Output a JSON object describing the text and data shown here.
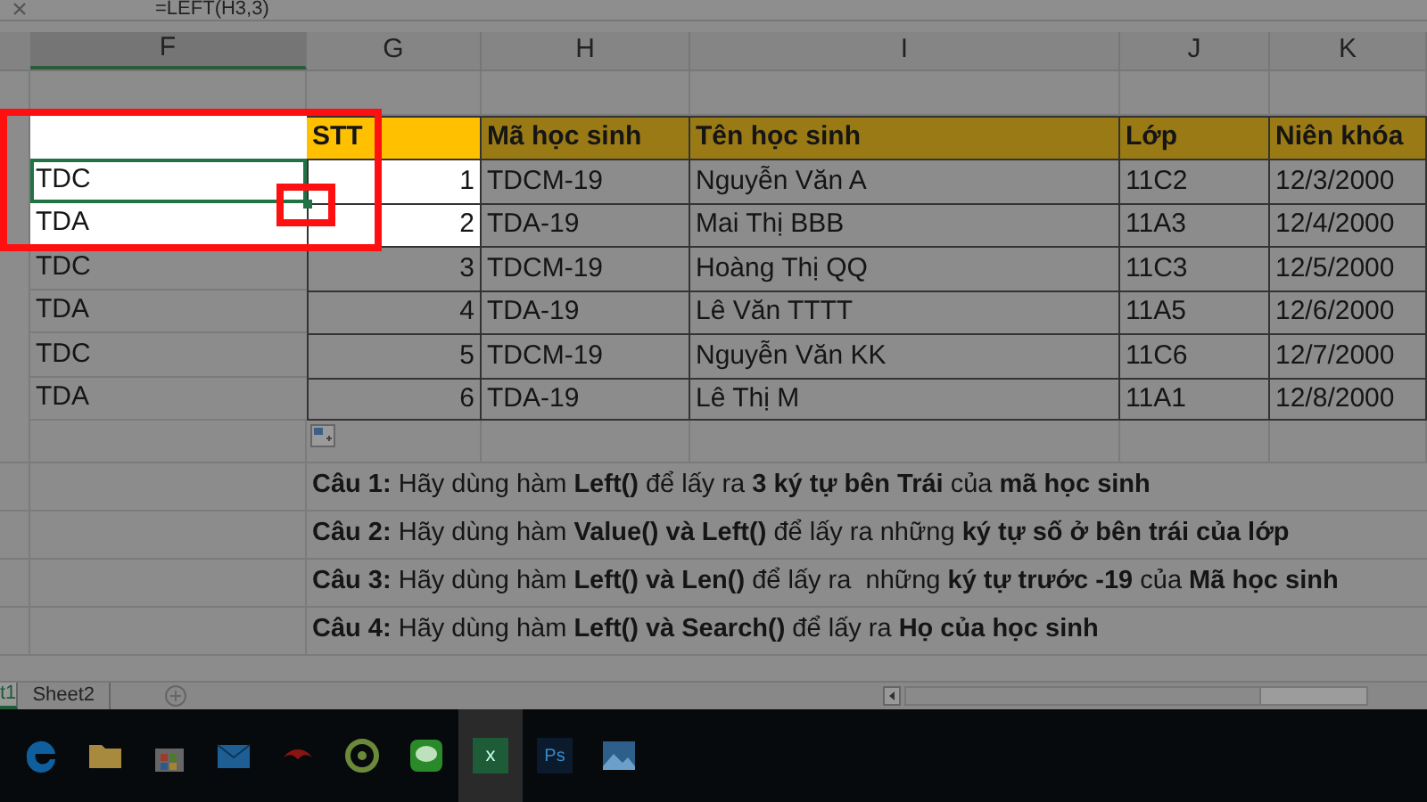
{
  "formula_bar": {
    "formula": "=LEFT(H3,3)"
  },
  "columns": [
    "F",
    "G",
    "H",
    "I",
    "J",
    "K"
  ],
  "table": {
    "headers": [
      "STT",
      "Mã học sinh",
      "Tên học sinh",
      "Lớp",
      "Niên khóa"
    ],
    "rows": [
      {
        "helper": "TDC",
        "selected": true,
        "highlighted": true,
        "cells": [
          "1",
          "TDCM-19",
          "Nguyễn Văn A",
          "11C2",
          "12/3/2000"
        ]
      },
      {
        "helper": "TDA",
        "selected": false,
        "highlighted": true,
        "cells": [
          "2",
          "TDA-19",
          "Mai Thị BBB",
          "11A3",
          "12/4/2000"
        ]
      },
      {
        "helper": "TDC",
        "selected": false,
        "highlighted": false,
        "cells": [
          "3",
          "TDCM-19",
          "Hoàng Thị QQ",
          "11C3",
          "12/5/2000"
        ]
      },
      {
        "helper": "TDA",
        "selected": false,
        "highlighted": false,
        "cells": [
          "4",
          "TDA-19",
          "Lê Văn TTTT",
          "11A5",
          "12/6/2000"
        ]
      },
      {
        "helper": "TDC",
        "selected": false,
        "highlighted": false,
        "cells": [
          "5",
          "TDCM-19",
          "Nguyễn Văn KK",
          "11C6",
          "12/7/2000"
        ]
      },
      {
        "helper": "TDA",
        "selected": false,
        "highlighted": false,
        "cells": [
          "6",
          "TDA-19",
          "Lê Thị M",
          "11A1",
          "12/8/2000"
        ]
      }
    ]
  },
  "questions": [
    "**Câu 1:** Hãy dùng hàm **Left()** để lấy ra **3 ký tự bên Trái** của **mã học sinh**",
    "**Câu 2:** Hãy dùng hàm **Value() và Left()** để lấy ra những **ký tự số ở bên trái của lớp**",
    "**Câu 3:** Hãy dùng hàm **Left() và Len()** để lấy ra  những **ký tự trước -19** của **Mã học sinh**",
    "**Câu 4:** Hãy dùng hàm **Left() và Search()** để lấy ra **Họ của học sinh**"
  ],
  "sheet_tabs": [
    {
      "label": "t1",
      "selected": true
    },
    {
      "label": "Sheet2",
      "selected": false
    }
  ],
  "taskbar": [
    {
      "kind": "edge"
    },
    {
      "kind": "folder"
    },
    {
      "kind": "store"
    },
    {
      "kind": "mail"
    },
    {
      "kind": "bird"
    },
    {
      "kind": "disc"
    },
    {
      "kind": "chat"
    },
    {
      "kind": "excel",
      "label": "x",
      "selected": true
    },
    {
      "kind": "photoshop",
      "label": "Ps",
      "selected": false
    },
    {
      "kind": "photos"
    }
  ]
}
